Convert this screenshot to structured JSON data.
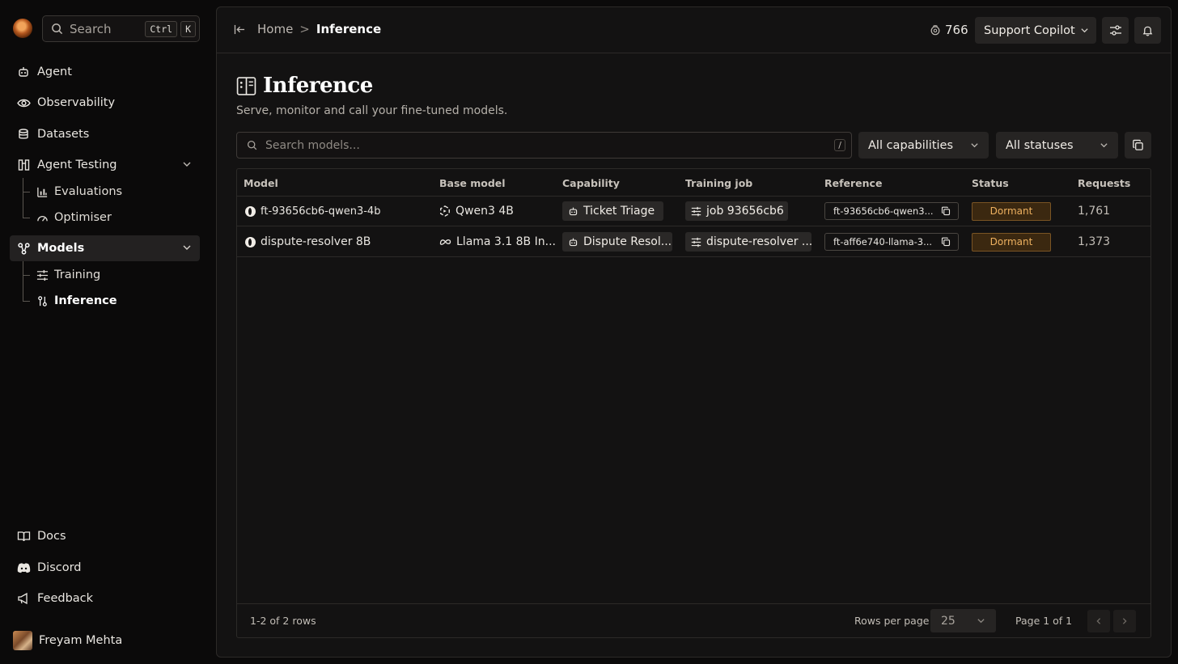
{
  "sidebar": {
    "search": {
      "label": "Search",
      "kbd1": "Ctrl",
      "kbd2": "K"
    },
    "nav": [
      {
        "label": "Agent",
        "icon": "robot-icon"
      },
      {
        "label": "Observability",
        "icon": "eye-icon"
      },
      {
        "label": "Datasets",
        "icon": "database-icon"
      },
      {
        "label": "Agent Testing",
        "icon": "testing-icon"
      },
      {
        "label": "Models",
        "icon": "models-icon"
      }
    ],
    "agent_testing_sub": [
      {
        "label": "Evaluations",
        "icon": "chart-icon"
      },
      {
        "label": "Optimiser",
        "icon": "gauge-icon"
      }
    ],
    "models_sub": [
      {
        "label": "Training",
        "icon": "sliders-icon"
      },
      {
        "label": "Inference",
        "icon": "inference-icon"
      }
    ],
    "footer": [
      {
        "label": "Docs",
        "icon": "book-icon"
      },
      {
        "label": "Discord",
        "icon": "discord-icon"
      },
      {
        "label": "Feedback",
        "icon": "megaphone-icon"
      }
    ],
    "user": {
      "name": "Freyam Mehta"
    }
  },
  "topbar": {
    "breadcrumb": {
      "home": "Home",
      "separator": ">",
      "current": "Inference"
    },
    "credits": "766",
    "project": "Support Copilot"
  },
  "page": {
    "title": "Inference",
    "subtitle": "Serve, monitor and call your fine-tuned models.",
    "search_placeholder": "Search models...",
    "search_shortcut": "/",
    "filters": {
      "capabilities": "All capabilities",
      "statuses": "All statuses"
    }
  },
  "table": {
    "columns": [
      "Model",
      "Base model",
      "Capability",
      "Training job",
      "Reference",
      "Status",
      "Requests"
    ],
    "rows": [
      {
        "model": "ft-93656cb6-qwen3-4b",
        "base_model": "Qwen3 4B",
        "base_icon": "qwen-icon",
        "capability": "Ticket Triage",
        "training_job": "job 93656cb6",
        "reference": "ft-93656cb6-qwen3...",
        "status": "Dormant",
        "requests": "1,761"
      },
      {
        "model": "dispute-resolver 8B",
        "base_model": "Llama 3.1 8B In...",
        "base_icon": "meta-icon",
        "capability": "Dispute Resol...",
        "training_job": "dispute-resolver ...",
        "reference": "ft-aff6e740-llama-3...",
        "status": "Dormant",
        "requests": "1,373"
      }
    ],
    "footer": {
      "count": "1-2 of 2 rows",
      "rows_per_page_label": "Rows per page",
      "rows_per_page": "25",
      "page": "Page 1 of 1"
    }
  },
  "colors": {
    "status_dormant": "#eeb160",
    "background": "#0b0a0a",
    "panel": "#131212"
  }
}
